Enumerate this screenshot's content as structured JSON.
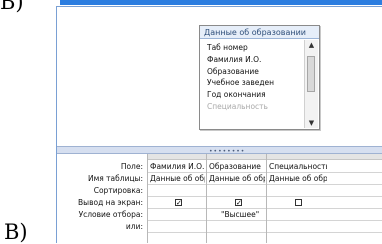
{
  "markers": {
    "top": "Б)",
    "bottom": "В)"
  },
  "table": {
    "title": "Данные об образовании",
    "fields": [
      "Таб номер",
      "Фамилия И.О.",
      "Образование",
      "Учебное заведен",
      "Год окончания",
      "Специальность"
    ]
  },
  "grid": {
    "row_labels": [
      "Поле:",
      "Имя таблицы:",
      "Сортировка:",
      "Вывод на экран:",
      "Условие отбора:",
      "или:"
    ],
    "columns": [
      {
        "field": "Фамилия И.О.",
        "table": "Данные об обр",
        "show": true,
        "criteria": ""
      },
      {
        "field": "Образование",
        "table": "Данные об обр",
        "show": true,
        "criteria": "\"Высшее\""
      },
      {
        "field": "Специальность",
        "table": "Данные об обр",
        "show": false,
        "criteria": ""
      }
    ]
  }
}
